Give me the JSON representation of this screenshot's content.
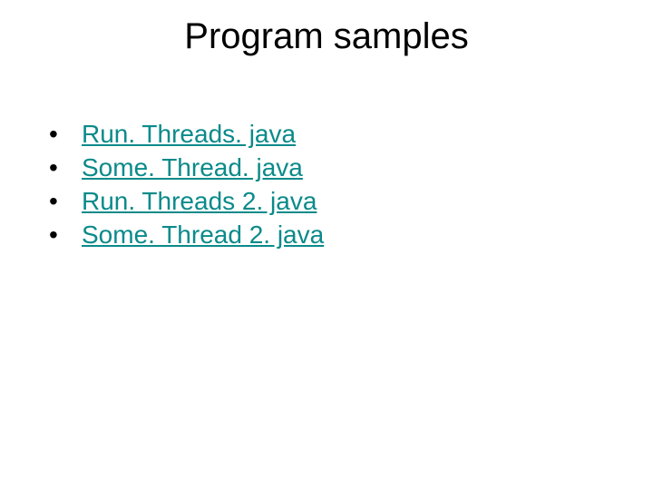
{
  "slide": {
    "title": "Program samples",
    "bullets": [
      {
        "label": "Run. Threads. java"
      },
      {
        "label": "Some. Thread. java"
      },
      {
        "label": "Run. Threads 2. java"
      },
      {
        "label": "Some. Thread 2. java"
      }
    ]
  }
}
